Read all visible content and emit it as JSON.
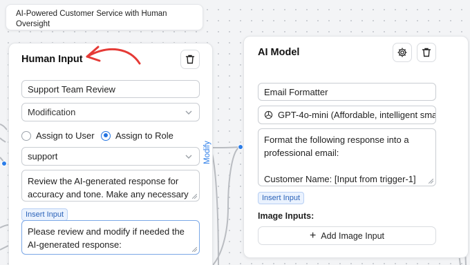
{
  "workflow_title": "AI-Powered Customer Service with Human Oversight",
  "human_input_node": {
    "title": "Human Input",
    "name_value": "Support Team Review",
    "type_value": "Modification",
    "assign_user_label": "Assign to User",
    "assign_role_label": "Assign to Role",
    "role_value": "support",
    "instructions_value": "Review the AI-generated response for accuracy and tone. Make any necessary",
    "insert_input_label": "Insert Input",
    "prompt_value": "Please review and modify if needed the AI-generated response:"
  },
  "edge_label": "Modify",
  "ai_model_node": {
    "title": "AI Model",
    "name_value": "Email Formatter",
    "model_value": "GPT-4o-mini (Affordable, intelligent sma",
    "prompt_line_1": "Format the following response into a professional email:",
    "prompt_line_2": "Customer Name: [Input from trigger-1]",
    "insert_input_label": "Insert Input",
    "image_inputs_label": "Image Inputs:",
    "add_image_label": "Add Image Input"
  },
  "icons": {
    "delete": "trash-icon",
    "settings": "gear-icon",
    "model": "openai-icon",
    "arrow": "annotation-arrow"
  },
  "colors": {
    "accent": "#2b7de9",
    "annotation": "#e53a36"
  }
}
